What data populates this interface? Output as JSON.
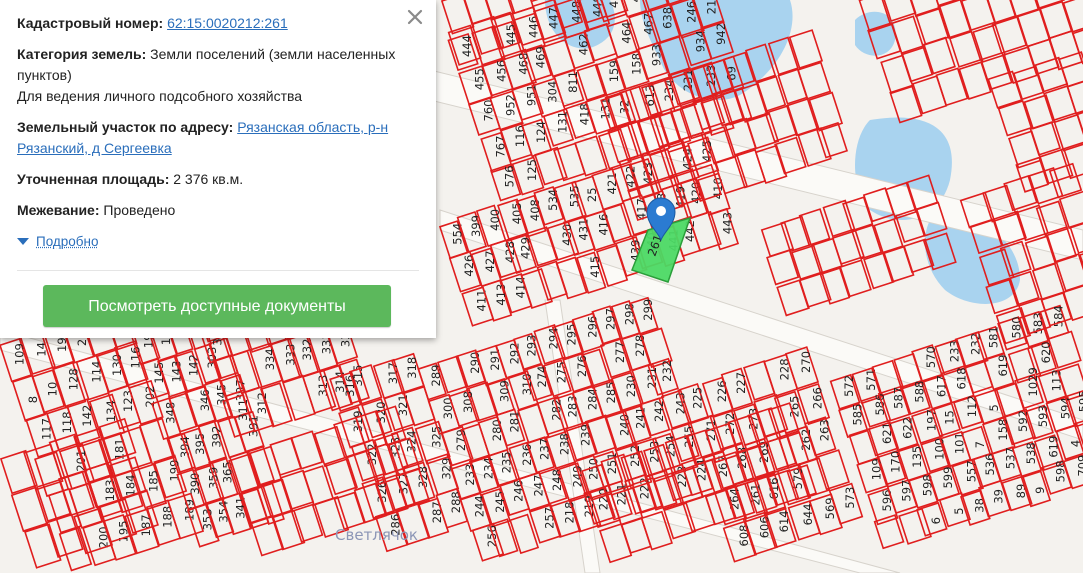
{
  "popup": {
    "cadastral_label": "Кадастровый номер:",
    "cadastral_value": "62:15:0020212:261",
    "category_label": "Категория земель:",
    "category_value": "Земли поселений (земли населенных пунктов)",
    "category_use": "Для ведения личного подсобного хозяйства",
    "address_label": "Земельный участок по адресу:",
    "address_value": "Рязанская область, р-н Рязанский, д Сергеевка",
    "area_label": "Уточненная площадь:",
    "area_value": "2 376 кв.м.",
    "survey_label": "Межевание:",
    "survey_value": "Проведено",
    "more_label": "Подробно",
    "docs_button": "Посмотреть доступные документы",
    "close_icon": "close-icon"
  },
  "map": {
    "place_label": "Светлячок",
    "selected_plot_label": "261",
    "marker_icon": "map-pin-icon",
    "colors": {
      "plot_border": "#e01e1e",
      "selected_fill": "#4cd964",
      "marker": "#2b7bd1",
      "water": "#a9d3ef",
      "button": "#5cb85c",
      "link": "#2a6ebb"
    },
    "plot_labels": [
      "109",
      "14",
      "19",
      "25",
      "27",
      "8",
      "10",
      "128",
      "114",
      "130",
      "116",
      "117",
      "118",
      "142",
      "134",
      "123",
      "202",
      "201",
      "181",
      "183",
      "184",
      "185",
      "199",
      "200",
      "195",
      "187",
      "188",
      "189",
      "190",
      "191",
      "192",
      "193",
      "139",
      "145",
      "143",
      "142",
      "303",
      "348",
      "346",
      "345",
      "397",
      "394",
      "395",
      "392",
      "391",
      "390",
      "359",
      "365",
      "353",
      "354",
      "341",
      "340",
      "339",
      "338",
      "337",
      "336",
      "335",
      "334",
      "333",
      "332",
      "331",
      "330",
      "311",
      "312",
      "313",
      "314",
      "315",
      "316",
      "317",
      "318",
      "319",
      "320",
      "321",
      "322",
      "323",
      "324",
      "325",
      "326",
      "327",
      "328",
      "329",
      "286",
      "287",
      "288",
      "289",
      "290",
      "291",
      "292",
      "293",
      "294",
      "295",
      "296",
      "297",
      "298",
      "299",
      "300",
      "308",
      "309",
      "310",
      "274",
      "275",
      "276",
      "277",
      "278",
      "279",
      "280",
      "281",
      "282",
      "283",
      "284",
      "285",
      "230",
      "231",
      "232",
      "233",
      "234",
      "235",
      "236",
      "237",
      "238",
      "239",
      "240",
      "241",
      "242",
      "243",
      "244",
      "245",
      "246",
      "247",
      "248",
      "249",
      "250",
      "251",
      "252",
      "253",
      "254",
      "255",
      "256",
      "257",
      "218",
      "219",
      "220",
      "221",
      "222",
      "223",
      "224",
      "225",
      "226",
      "227",
      "228",
      "270",
      "271",
      "272",
      "273",
      "265",
      "266",
      "267",
      "268",
      "269",
      "262",
      "263",
      "264",
      "261",
      "616",
      "579",
      "608",
      "606",
      "614",
      "644",
      "569",
      "573",
      "572",
      "571",
      "570",
      "233",
      "232",
      "581",
      "580",
      "583",
      "584",
      "585",
      "586",
      "587",
      "588",
      "617",
      "618",
      "619",
      "620",
      "621",
      "622",
      "197",
      "15",
      "112",
      "5",
      "1029",
      "113",
      "109",
      "170",
      "135",
      "100",
      "101",
      "7",
      "158",
      "592",
      "593",
      "594",
      "595",
      "596",
      "597",
      "598",
      "599",
      "557",
      "536",
      "537",
      "538",
      "619",
      "4",
      "3",
      "6",
      "5",
      "38",
      "39",
      "89",
      "9",
      "598",
      "709",
      "559",
      "554",
      "399",
      "400",
      "405",
      "408",
      "534",
      "535",
      "25",
      "421",
      "422",
      "423",
      "424",
      "425",
      "426",
      "427",
      "428",
      "429",
      "430",
      "431",
      "416",
      "417",
      "418",
      "419",
      "420",
      "410",
      "411",
      "413",
      "414",
      "415",
      "439",
      "440",
      "441",
      "442",
      "443",
      "444",
      "445",
      "446",
      "447",
      "448",
      "449",
      "450",
      "451",
      "452",
      "453",
      "454",
      "455",
      "456",
      "468",
      "469",
      "462",
      "464",
      "467",
      "638",
      "246",
      "21",
      "760",
      "952",
      "951",
      "304",
      "811",
      "159",
      "158",
      "933",
      "934",
      "942",
      "767",
      "116",
      "124",
      "131",
      "418",
      "131",
      "32",
      "613",
      "234",
      "231",
      "233",
      "69",
      "576",
      "125"
    ]
  }
}
